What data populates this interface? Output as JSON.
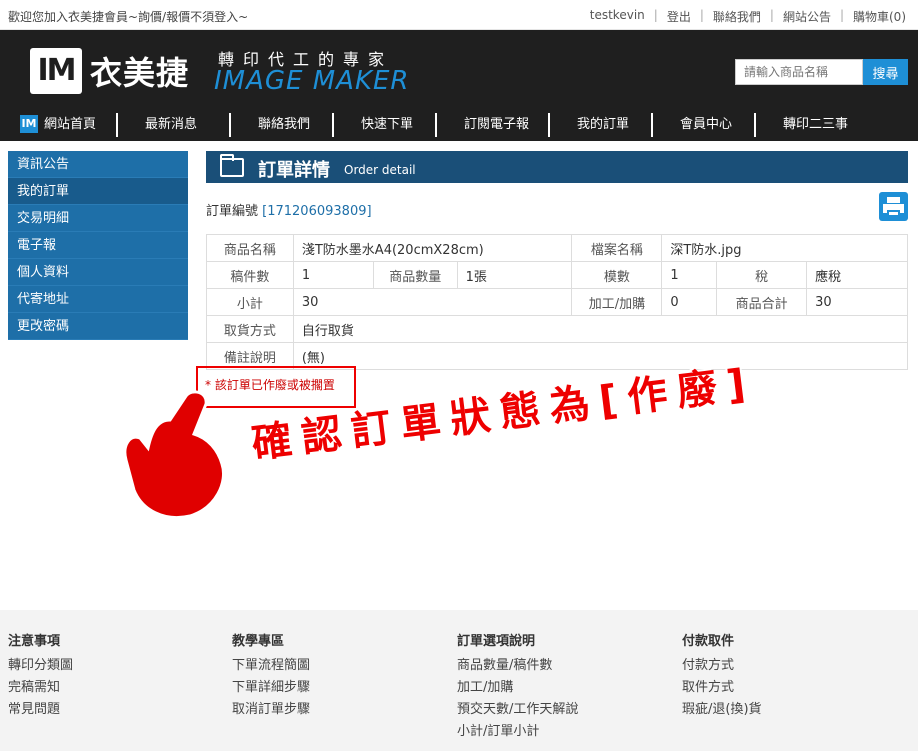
{
  "topbar": {
    "welcome": "歡迎您加入衣美捷會員~詢價/報價不須登入~",
    "links": [
      "testkevin",
      "登出",
      "聯絡我們",
      "網站公告",
      "購物車(0)"
    ]
  },
  "header": {
    "logo_mark": "IM",
    "logo_cn": "衣美捷",
    "logo_tagline": "轉印代工的專家",
    "logo_en": "IMAGE MAKER",
    "search_placeholder": "請輸入商品名稱",
    "search_button": "搜尋"
  },
  "nav": {
    "items": [
      "網站首頁",
      "最新消息",
      "聯絡我們",
      "快速下單",
      "訂閱電子報",
      "我的訂單",
      "會員中心",
      "轉印二三事"
    ]
  },
  "sidebar": {
    "items": [
      "資訊公告",
      "我的訂單",
      "交易明細",
      "電子報",
      "個人資料",
      "代寄地址",
      "更改密碼"
    ],
    "active_index": 1
  },
  "main": {
    "title": "訂單詳情",
    "title_en": "Order detail",
    "order_no_label": "訂單編號",
    "order_no": "[171206093809]",
    "rows": {
      "product_name_label": "商品名稱",
      "product_name": "淺T防水墨水A4(20cmX28cm)",
      "file_name_label": "檔案名稱",
      "file_name": "深T防水.jpg",
      "drafts_label": "稿件數",
      "drafts": "1",
      "qty_label": "商品數量",
      "qty": "1張",
      "molds_label": "模數",
      "molds": "1",
      "tax_label": "稅",
      "tax": "應稅",
      "subtotal_label": "小計",
      "subtotal": "30",
      "extra_label": "加工/加購",
      "extra": "0",
      "product_total_label": "商品合計",
      "product_total": "30",
      "pickup_label": "取貨方式",
      "pickup": "自行取貨",
      "note_label": "備註說明",
      "note": "(無)"
    },
    "warning": "* 該訂單已作廢或被擱置"
  },
  "annotation": {
    "text": "確認訂單狀態為[作廢]",
    "color": "#e00000"
  },
  "footer": {
    "columns": [
      {
        "heading": "注意事項",
        "links": [
          "轉印分類圖",
          "完稿需知",
          "常見問題"
        ]
      },
      {
        "heading": "教學專區",
        "links": [
          "下單流程簡圖",
          "下單詳細步驟",
          "取消訂單步驟"
        ]
      },
      {
        "heading": "訂單選項說明",
        "links": [
          "商品數量/稿件數",
          "加工/加購",
          "預交天數/工作天解說",
          "小計/訂單小計"
        ]
      },
      {
        "heading": "付款取件",
        "links": [
          "付款方式",
          "取件方式",
          "瑕疵/退(換)貨"
        ]
      }
    ]
  }
}
